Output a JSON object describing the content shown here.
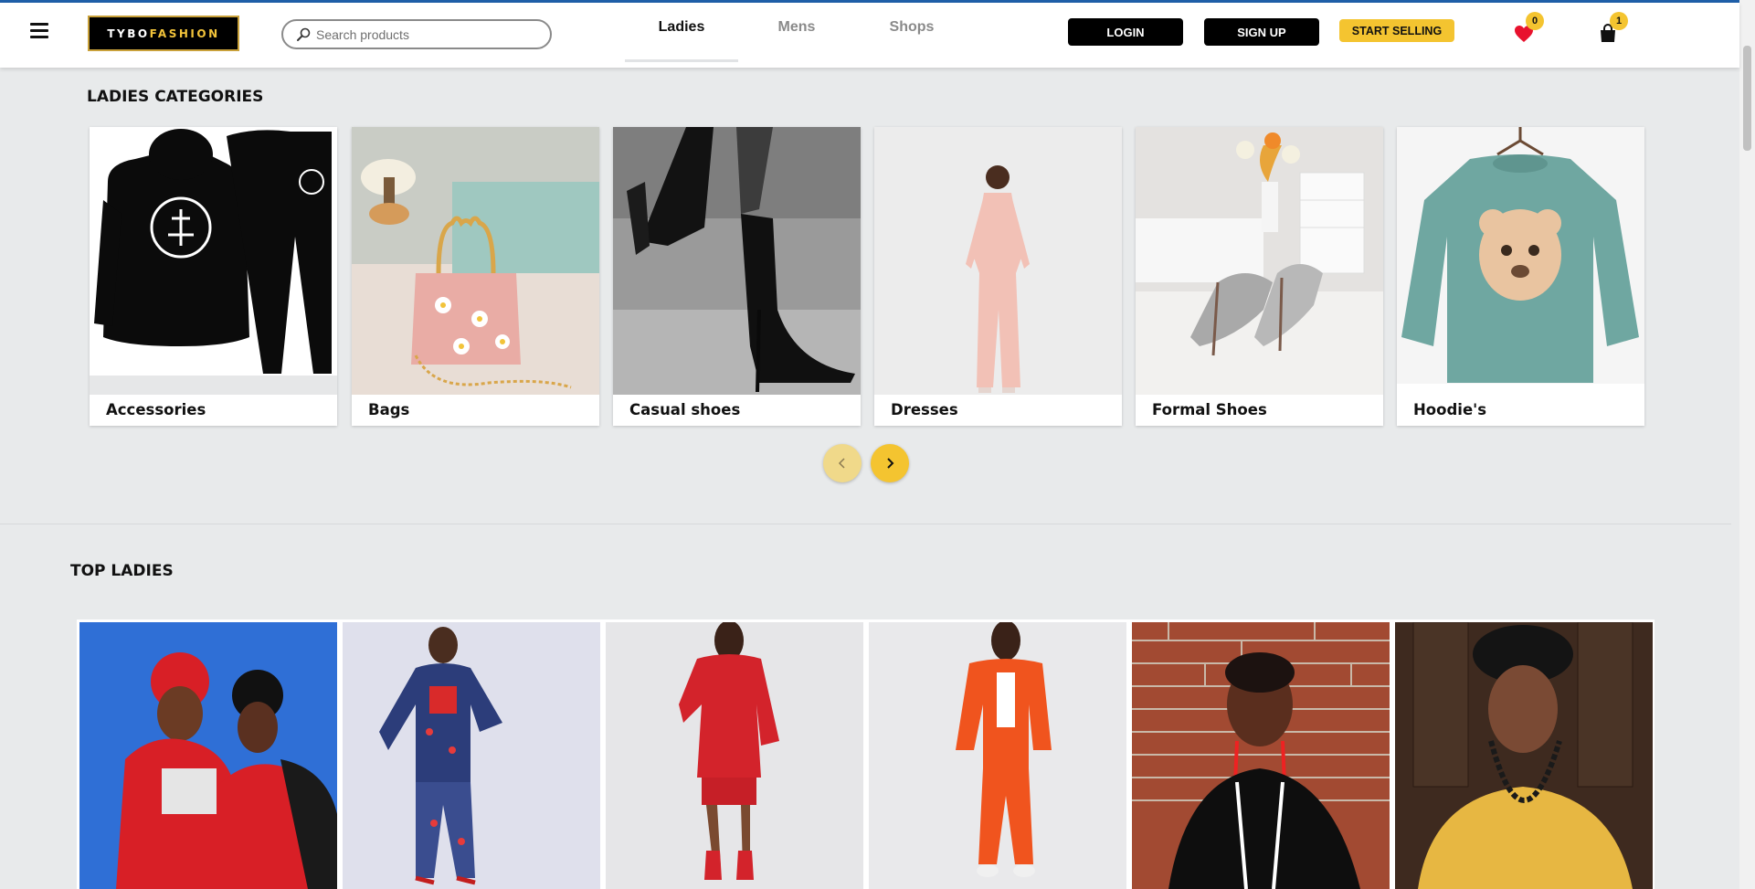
{
  "header": {
    "logo": {
      "part1": "TYBO",
      "part2": "FASHION"
    },
    "search": {
      "placeholder": "Search products",
      "value": ""
    },
    "tabs": [
      {
        "label": "Ladies",
        "active": true
      },
      {
        "label": "Mens",
        "active": false
      },
      {
        "label": "Shops",
        "active": false
      }
    ],
    "login_label": "LOGIN",
    "signup_label": "SIGN UP",
    "sell_label": "START SELLING",
    "wishlist_count": "0",
    "cart_count": "1",
    "icons": {
      "menu": "hamburger-icon",
      "search": "search-icon",
      "wishlist": "heart-icon",
      "cart": "shopping-bag-icon"
    }
  },
  "ladies_categories": {
    "title": "LADIES CATEGORIES",
    "items": [
      {
        "label": "Accessories"
      },
      {
        "label": "Bags"
      },
      {
        "label": "Casual shoes"
      },
      {
        "label": "Dresses"
      },
      {
        "label": "Formal Shoes"
      },
      {
        "label": "Hoodie's"
      }
    ],
    "carousel_icons": {
      "prev": "chevron-left-icon",
      "next": "chevron-right-icon"
    }
  },
  "top_ladies": {
    "title": "TOP LADIES",
    "item_count": 6
  },
  "colors": {
    "accent_yellow": "#f4c430",
    "header_bg": "#ffffff",
    "page_bg": "#e8eaeb",
    "badge": "#f4c430",
    "heart": "#e8112d",
    "top_accent": "#1f5fa8"
  }
}
